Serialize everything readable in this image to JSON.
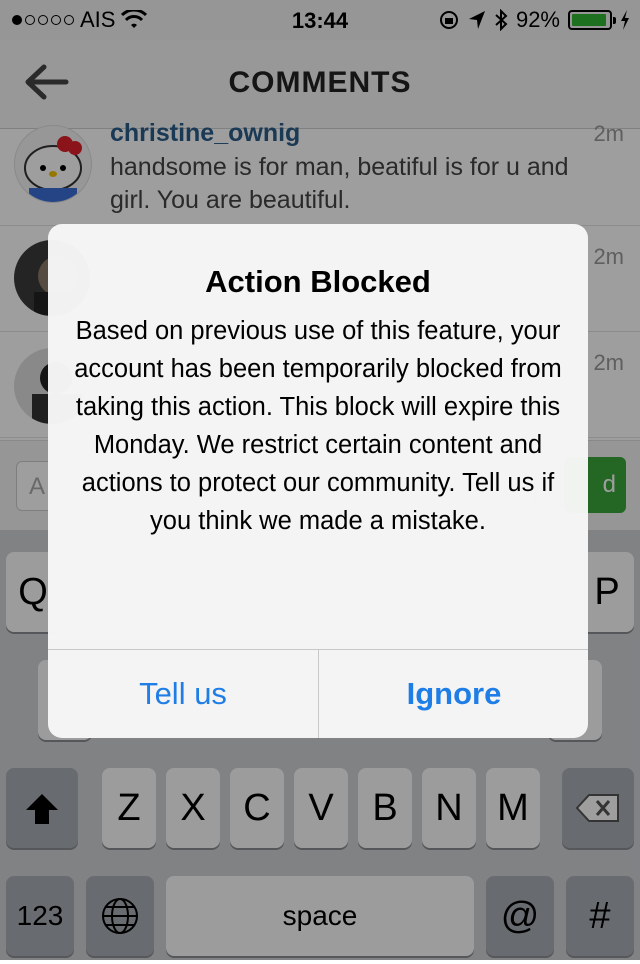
{
  "status_bar": {
    "carrier": "AIS",
    "time": "13:44",
    "battery": "92%",
    "battery_level": 0.92,
    "signal_bars_filled": 1
  },
  "nav": {
    "title": "COMMENTS"
  },
  "comments": [
    {
      "user": "christine_ownig",
      "time": "2m",
      "text": "handsome is for man, beatiful is for u and girl. You are beautiful."
    },
    {
      "user": "",
      "time": "2m",
      "text": ""
    },
    {
      "user": "",
      "time": "2m",
      "text": ""
    }
  ],
  "comment_input": {
    "placeholder": "A",
    "send_label": "d"
  },
  "keyboard": {
    "row1_visible": [
      "Q",
      "P"
    ],
    "row3": [
      "Z",
      "X",
      "C",
      "V",
      "B",
      "N",
      "M"
    ],
    "numbers_label": "123",
    "space_label": "space",
    "at_label": "@",
    "hash_label": "#"
  },
  "alert": {
    "title": "Action Blocked",
    "message": "Based on previous use of this feature, your account has been temporarily blocked from taking this action. This block will expire this Monday. We restrict certain content and actions to protect our community. Tell us if you think we made a mistake.",
    "button_left": "Tell us",
    "button_right": "Ignore"
  },
  "colors": {
    "link_blue": "#1f7ee6",
    "username_blue": "#2b5c8a",
    "send_green": "#3aa63a"
  }
}
